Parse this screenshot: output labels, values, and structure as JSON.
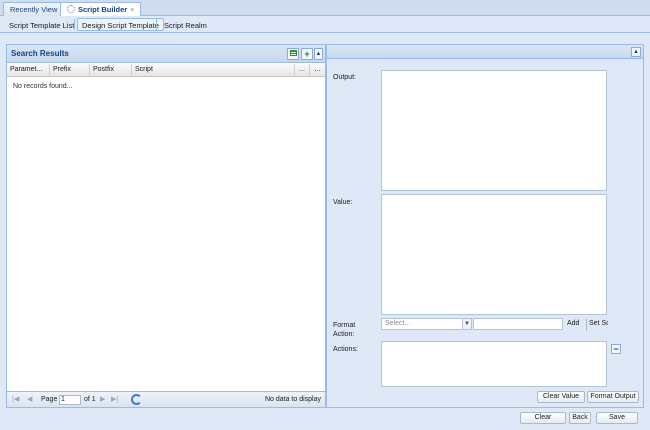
{
  "tabs": {
    "recent": "Recently View",
    "builder": "Script Builder",
    "close": "×"
  },
  "subtabs": [
    "Script Template List",
    "Design Script Template",
    "Script Realm"
  ],
  "results": {
    "title": "Search Results",
    "add": "+",
    "collapse": "▲",
    "columns": [
      "Paramet...",
      "Prefix",
      "Postfix",
      "Script",
      "...",
      "..."
    ],
    "empty": "No records found..."
  },
  "pager": {
    "first": "|◀",
    "prev": "◀",
    "page_label": "Page",
    "page_value": "1",
    "of_label": "of 1",
    "next": "▶",
    "last": "▶|",
    "status": "No data to display"
  },
  "form": {
    "collapse": "▲",
    "output_label": "Output:",
    "value_label": "Value:",
    "format_action_label": "Format Action:",
    "select_placeholder": "Select...",
    "trigger": "▼",
    "add": "Add",
    "set": "Set Sc",
    "actions_label": "Actions:",
    "remove": "−",
    "clear_value": "Clear Value",
    "format_output": "Format Output"
  },
  "bottom": {
    "clear": "Clear",
    "back": "Back",
    "save": "Save"
  }
}
